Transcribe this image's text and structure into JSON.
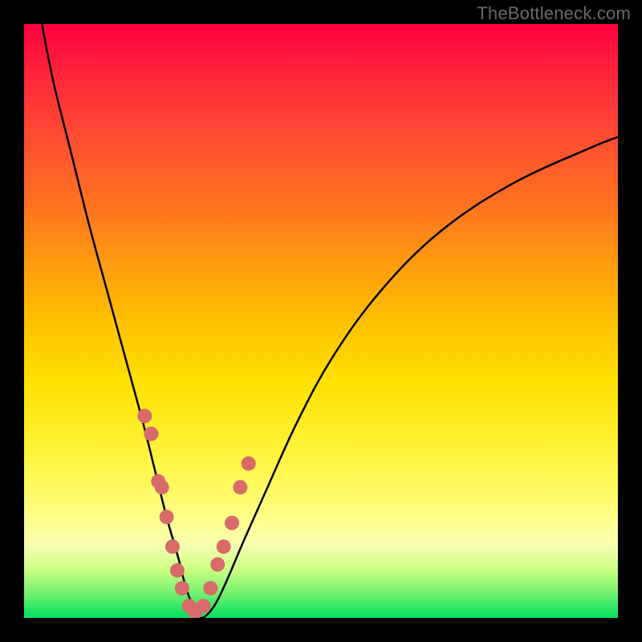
{
  "watermark": "TheBottleneck.com",
  "chart_data": {
    "type": "line",
    "title": "",
    "xlabel": "",
    "ylabel": "",
    "xlim": [
      0,
      100
    ],
    "ylim": [
      0,
      100
    ],
    "series": [
      {
        "name": "bottleneck-curve",
        "x": [
          3,
          5,
          8,
          11,
          14,
          17,
          20,
          22,
          24,
          26,
          27,
          28,
          29,
          30,
          32,
          34,
          37,
          41,
          46,
          52,
          60,
          70,
          82,
          95,
          100
        ],
        "y": [
          100,
          90,
          78,
          66,
          55,
          44,
          33,
          25,
          17,
          10,
          6,
          3,
          1,
          0,
          2,
          6,
          13,
          22,
          33,
          44,
          55,
          65,
          73,
          79,
          81
        ]
      }
    ],
    "markers": {
      "name": "highlight-dots",
      "x": [
        20.3,
        21.4,
        22.6,
        23.2,
        24.0,
        25.0,
        25.8,
        26.6,
        27.8,
        28.8,
        30.2,
        31.4,
        32.6,
        33.6,
        35.0,
        36.4,
        37.8
      ],
      "y": [
        34,
        31,
        23,
        22,
        17,
        12,
        8,
        5,
        2,
        1,
        2,
        5,
        9,
        12,
        16,
        22,
        26
      ]
    },
    "marker_color": "#d86a6a",
    "curve_color": "#000000",
    "background_gradient": [
      "#ff0040",
      "#ffc000",
      "#ffff80",
      "#00e060"
    ]
  }
}
